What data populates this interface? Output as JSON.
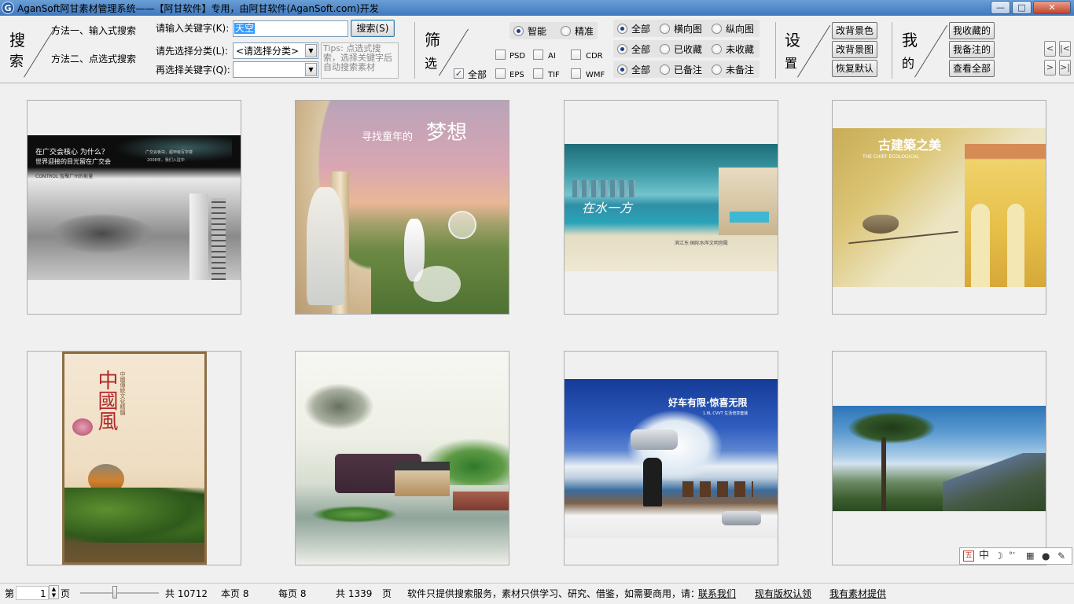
{
  "window": {
    "title": "AganSoft阿甘素材管理系统——【阿甘软件】专用，由阿甘软件(AganSoft.com)开发",
    "app_icon": "G",
    "minimize": "—",
    "maximize": "□",
    "close": "✕"
  },
  "search": {
    "heading_1": "搜",
    "heading_2": "索",
    "method_input": "方法一、输入式搜索",
    "method_click": "方法二、点选式搜索",
    "keyword_label": "请输入关键字(K):",
    "keyword_value": "天空",
    "search_button": "搜索(S)",
    "category_label": "请先选择分类(L):",
    "category_value": "<请选择分类>",
    "keyword2_label": "再选择关键字(Q):",
    "keyword2_value": "",
    "tips": "Tips: 点选式搜索，选择关键字后自动搜索素材"
  },
  "filter": {
    "heading_1": "筛",
    "heading_2": "选",
    "mode_smart": "智能",
    "mode_exact": "精准",
    "all_types": "全部",
    "types": [
      "PSD",
      "AI",
      "CDR",
      "EPS",
      "TIF",
      "WMF"
    ],
    "orient": [
      "全部",
      "横向图",
      "纵向图"
    ],
    "fav": [
      "全部",
      "已收藏",
      "未收藏"
    ],
    "note": [
      "全部",
      "已备注",
      "未备注"
    ]
  },
  "settings": {
    "heading_1": "设",
    "heading_2": "置",
    "bg_color": "改背景色",
    "bg_image": "改背景图",
    "restore": "恢复默认"
  },
  "mine": {
    "heading_1": "我",
    "heading_2": "的",
    "favorites": "我收藏的",
    "notes": "我备注的",
    "view_all": "查看全部"
  },
  "nav": {
    "prev": "<",
    "first": "|<",
    "next": ">",
    "last": ">|"
  },
  "thumbs": [
    {
      "line1": "在广交会核心 为什么？",
      "line2": "世界迎接的目光留在广交会",
      "line3": "CONTROL 智聚广州的能量",
      "line4": "广交会板块，超甲级写字楼",
      "line5": "2008年，我们入驻中"
    },
    {
      "line1": "寻找童年的",
      "line2": "梦想"
    },
    {
      "line1": "在水一方",
      "line2": "滨江东·国际水岸文明宫殿"
    },
    {
      "line1": "古建築之美",
      "line2": "THE CHIEF ECOLOGICAL"
    },
    {
      "line1": "中國風",
      "line2": "中國傳統文化精髓"
    },
    {
      "line1": ""
    },
    {
      "line1": "好车有限·惊喜无限",
      "line2": "1.8L CVVT 生活倍享套装"
    },
    {
      "line1": ""
    }
  ],
  "ime": {
    "mode": "中",
    "icons": [
      "ime-logo-icon",
      "moon-icon",
      "punct-icon",
      "keyboard-icon",
      "user-icon",
      "wrench-icon"
    ]
  },
  "status": {
    "page_label": "第",
    "page_value": "1",
    "page_unit": "页",
    "total": "共 10712",
    "this_page": "本页 8",
    "per_page": "每页 8",
    "total_pages": "共 1339",
    "pages_unit": "页",
    "disclaimer": "软件只提供搜索服务，素材只供学习、研究、借鉴，如需要商用，请：",
    "contact": "联系我们",
    "report": "现有版权认领",
    "provide": "我有素材提供"
  }
}
